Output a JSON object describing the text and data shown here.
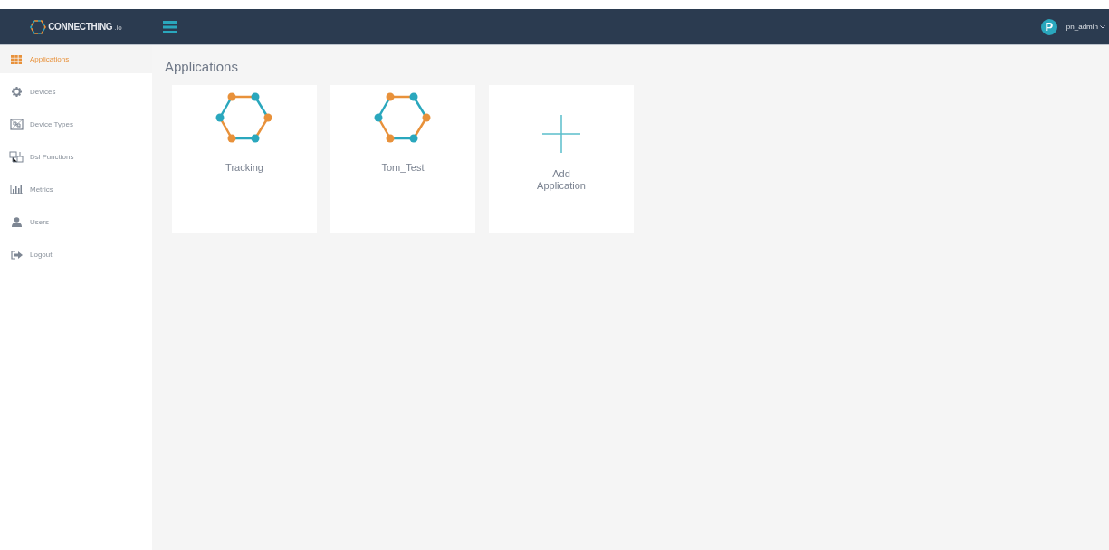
{
  "header": {
    "logo": {
      "name": "CONNECTHING",
      "suffix": ".io"
    },
    "user": {
      "initial": "P",
      "name": "pn_admin"
    }
  },
  "sidebar": {
    "items": [
      {
        "label": "Applications",
        "kind": "grid",
        "selected": true
      },
      {
        "label": "Devices",
        "kind": "gear",
        "selected": false
      },
      {
        "label": "Device Types",
        "kind": "types",
        "selected": false
      },
      {
        "label": "Dsl Functions",
        "kind": "functions",
        "selected": false
      },
      {
        "label": "Metrics",
        "kind": "chart",
        "selected": false
      },
      {
        "label": "Users",
        "kind": "user",
        "selected": false
      },
      {
        "label": "Logout",
        "kind": "logout",
        "selected": false
      }
    ]
  },
  "page": {
    "title": "Applications",
    "cards": [
      {
        "kind": "app",
        "label": "Tracking"
      },
      {
        "kind": "app",
        "label": "Tom_Test"
      },
      {
        "kind": "add",
        "label": "Add Application"
      }
    ]
  }
}
